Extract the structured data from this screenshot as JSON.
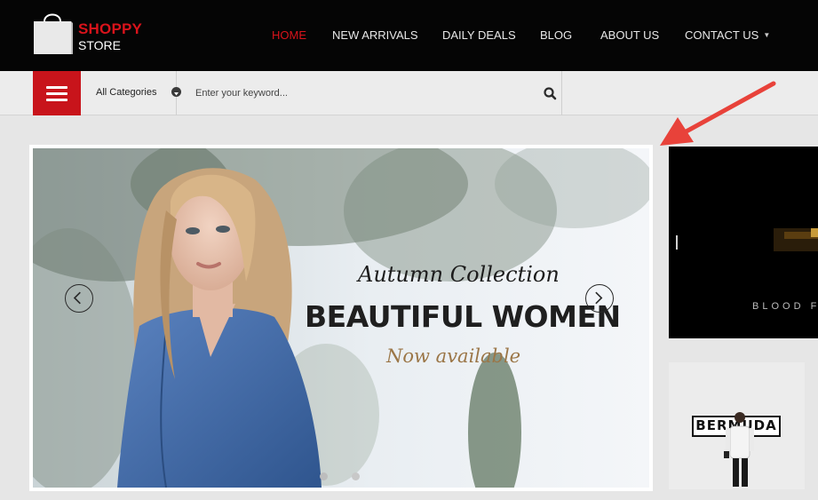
{
  "brand": {
    "name": "SHOPPY",
    "sub": "STORE",
    "accent_color": "#d9131b"
  },
  "nav": {
    "items": [
      {
        "label": "HOME",
        "active": true
      },
      {
        "label": "NEW ARRIVALS",
        "active": false
      },
      {
        "label": "DAILY DEALS",
        "active": false
      },
      {
        "label": "BLOG",
        "active": false
      },
      {
        "label": "ABOUT US",
        "active": false
      },
      {
        "label": "CONTACT US",
        "active": false,
        "has_dropdown": true
      }
    ]
  },
  "search": {
    "category_selected": "All Categories",
    "placeholder": "Enter your keyword...",
    "icons": {
      "menu": "hamburger-menu-icon",
      "dropdown": "chevron-down-icon",
      "submit": "search-icon"
    }
  },
  "slider": {
    "subtitle": "Autumn Collection",
    "title": "BEAUTIFUL WOMEN",
    "tagline": "Now available",
    "tagline_color": "#9b7647",
    "dots": 2,
    "active_dot": 0,
    "icons": {
      "prev": "chevron-left-icon",
      "next": "chevron-right-icon"
    }
  },
  "banners": {
    "top_text": "BLOOD F",
    "bottom_logo": "BERMUDA"
  }
}
